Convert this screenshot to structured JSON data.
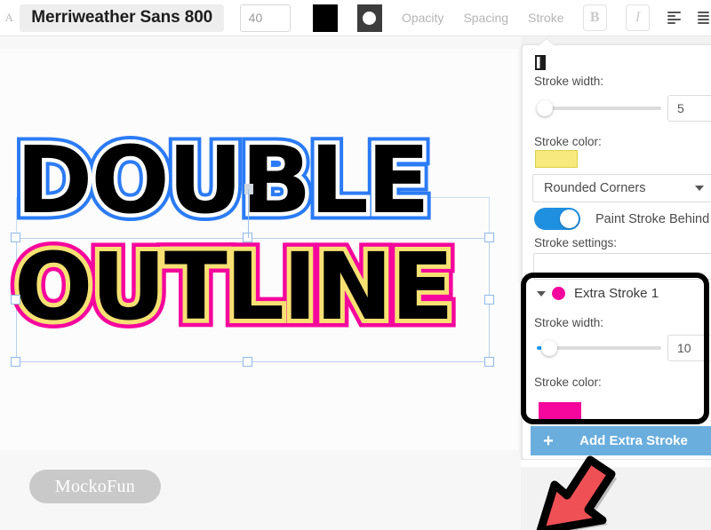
{
  "toolbar": {
    "text_icon": "text-A-icon",
    "font_name": "Merriweather Sans 800",
    "font_size": "40",
    "fill_color_swatch": "#000000",
    "opacity_swatch_icon": "circle-icon",
    "opacity_label": "Opacity",
    "spacing_label": "Spacing",
    "stroke_label": "Stroke",
    "bold_label": "B",
    "italic_label": "I",
    "align_icon": "align-left-icon",
    "align_icon_2": "align-justify-icon"
  },
  "canvas": {
    "line1": "DOUBLE",
    "line2": "OUTLINE",
    "line1_outer_stroke_color": "#2b7bf5",
    "line1_inner_stroke_color": "#ffffff",
    "line2_outer_stroke_color": "#f5069d",
    "line2_inner_stroke_color": "#f7e173",
    "fill_color": "#000000",
    "watermark": "MockoFun",
    "selection_color": "#8fb9e8"
  },
  "panel": {
    "preview_icon": "stroke-preview-icon",
    "stroke_width_label": "Stroke width:",
    "stroke_width_value": "5",
    "stroke_color_label": "Stroke color:",
    "stroke_color_value": "#f7e97e",
    "corner_style": "Rounded Corners",
    "paint_stroke_behind_label": "Paint Stroke Behind",
    "paint_stroke_behind_state": "on",
    "stroke_settings_label": "Stroke settings:",
    "stroke_settings_value": "",
    "extra": {
      "title": "Extra Stroke 1",
      "dot_color": "#f5069d",
      "stroke_width_label": "Stroke width:",
      "stroke_width_value": "10",
      "stroke_color_label": "Stroke color:",
      "stroke_color_value": "#f5069d"
    },
    "add_extra_stroke_label": "Add Extra Stroke",
    "add_extra_stroke_plus": "+",
    "accent_color": "#1f8fe0",
    "button_color": "#6aaede"
  },
  "annotation": {
    "arrow_icon": "pointer-arrow-icon",
    "arrow_fill": "#ee5055",
    "arrow_outline": "#000000"
  }
}
